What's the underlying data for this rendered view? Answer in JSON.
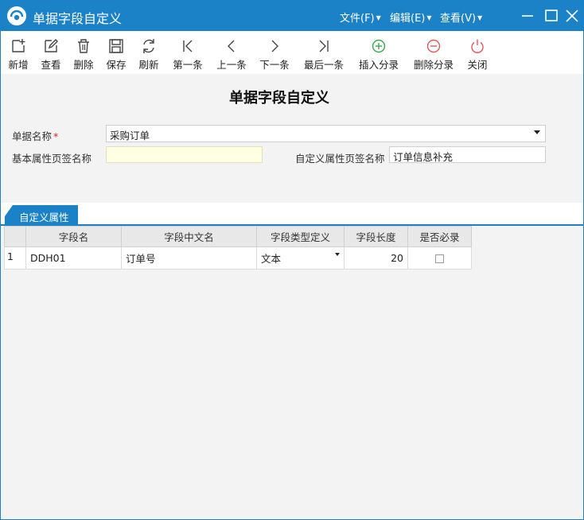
{
  "window": {
    "title": "单据字段自定义",
    "menus": [
      {
        "label": "文件(F)"
      },
      {
        "label": "编辑(E)"
      },
      {
        "label": "查看(V)"
      }
    ]
  },
  "toolbar": {
    "buttons": [
      {
        "id": "add",
        "label": "新增",
        "icon": "add-doc-icon"
      },
      {
        "id": "view",
        "label": "查看",
        "icon": "edit-icon"
      },
      {
        "id": "delete",
        "label": "删除",
        "icon": "trash-icon"
      },
      {
        "id": "save",
        "label": "保存",
        "icon": "save-icon"
      },
      {
        "id": "refresh",
        "label": "刷新",
        "icon": "refresh-icon"
      },
      {
        "id": "first",
        "label": "第一条",
        "icon": "first-icon"
      },
      {
        "id": "prev",
        "label": "上一条",
        "icon": "prev-icon"
      },
      {
        "id": "next",
        "label": "下一条",
        "icon": "next-icon"
      },
      {
        "id": "last",
        "label": "最后一条",
        "icon": "last-icon"
      },
      {
        "id": "insert-entry",
        "label": "插入分录",
        "icon": "plus-circle-icon"
      },
      {
        "id": "delete-entry",
        "label": "删除分录",
        "icon": "minus-circle-icon"
      },
      {
        "id": "close",
        "label": "关闭",
        "icon": "power-icon"
      }
    ]
  },
  "form": {
    "title": "单据字段自定义",
    "doc_name_label": "单据名称",
    "required_mark": "*",
    "doc_name_value": "采购订单",
    "basic_tab_label": "基本属性页签名称",
    "basic_tab_value": "",
    "custom_tab_label": "自定义属性页签名称",
    "custom_tab_value": "订单信息补充"
  },
  "tabs": [
    {
      "label": "自定义属性",
      "active": true
    }
  ],
  "grid": {
    "columns": [
      "字段名",
      "字段中文名",
      "字段类型定义",
      "字段长度",
      "是否必录"
    ],
    "rows": [
      {
        "index": "1",
        "field_name": "DDH01",
        "cn_name": "订单号",
        "type": "文本",
        "length": "20",
        "required": false
      }
    ]
  },
  "colors": {
    "accent": "#1c82c8",
    "required": "#e02020",
    "insert_icon": "#3aa84a",
    "delete_icon": "#e0575a",
    "close_icon": "#e0575a"
  }
}
